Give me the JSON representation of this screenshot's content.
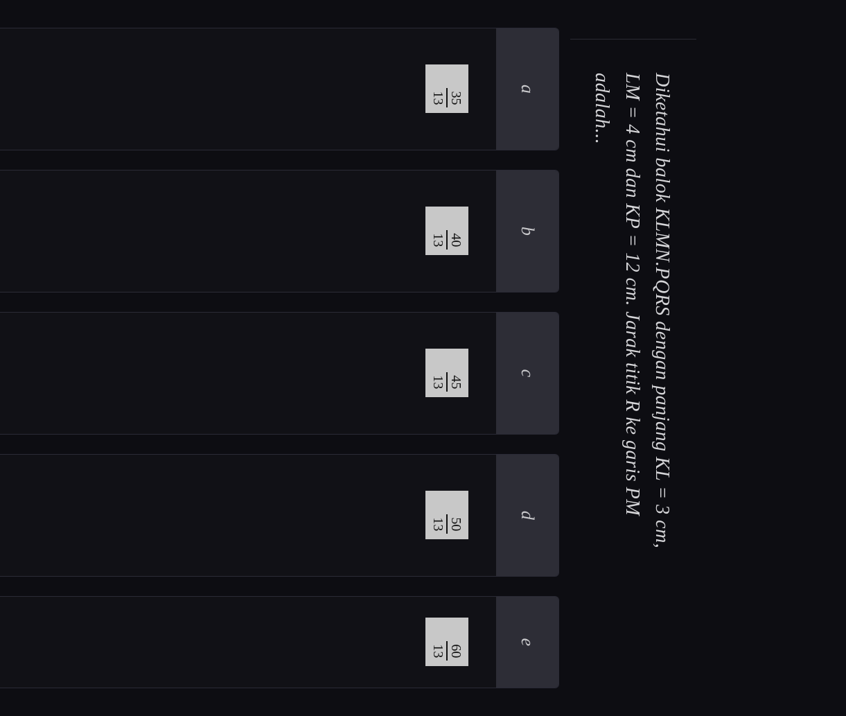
{
  "question": {
    "line1": "Diketahui balok KLMN.PQRS dengan panjang KL = 3 cm,",
    "line2": "LM = 4 cm dan KP = 12 cm. Jarak titik R ke garis PM",
    "line3": "adalah..."
  },
  "options": [
    {
      "letter": "a",
      "numerator": "35",
      "denominator": "13",
      "cut": false
    },
    {
      "letter": "b",
      "numerator": "40",
      "denominator": "13",
      "cut": false
    },
    {
      "letter": "c",
      "numerator": "45",
      "denominator": "13",
      "cut": false
    },
    {
      "letter": "d",
      "numerator": "50",
      "denominator": "13",
      "cut": false
    },
    {
      "letter": "e",
      "numerator": "60",
      "denominator": "13",
      "cut": true
    }
  ]
}
